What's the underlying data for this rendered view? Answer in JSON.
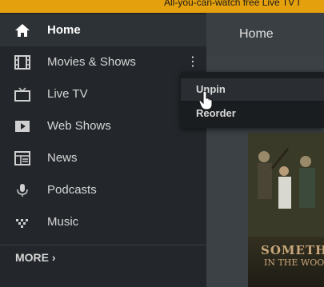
{
  "banner": {
    "text": "All-you-can-watch free Live TV I"
  },
  "sidebar": {
    "items": [
      {
        "label": "Home",
        "icon": "home-icon",
        "active": true
      },
      {
        "label": "Movies & Shows",
        "icon": "film-icon"
      },
      {
        "label": "Live TV",
        "icon": "tv-icon"
      },
      {
        "label": "Web Shows",
        "icon": "play-icon"
      },
      {
        "label": "News",
        "icon": "news-icon"
      },
      {
        "label": "Podcasts",
        "icon": "microphone-icon"
      },
      {
        "label": "Music",
        "icon": "music-icon"
      }
    ],
    "more_label": "MORE ›",
    "item_more_icon": "⋮"
  },
  "main": {
    "title": "Home",
    "poster": {
      "title": "SOMETH",
      "subtitle": "IN THE WOO"
    }
  },
  "context_menu": {
    "items": [
      {
        "label": "Unpin"
      },
      {
        "label": "Reorder"
      }
    ]
  },
  "colors": {
    "accent": "#e5a00d",
    "sidebar_bg": "#23272b",
    "main_bg": "#3b4145",
    "menu_bg": "#1a1d20"
  }
}
